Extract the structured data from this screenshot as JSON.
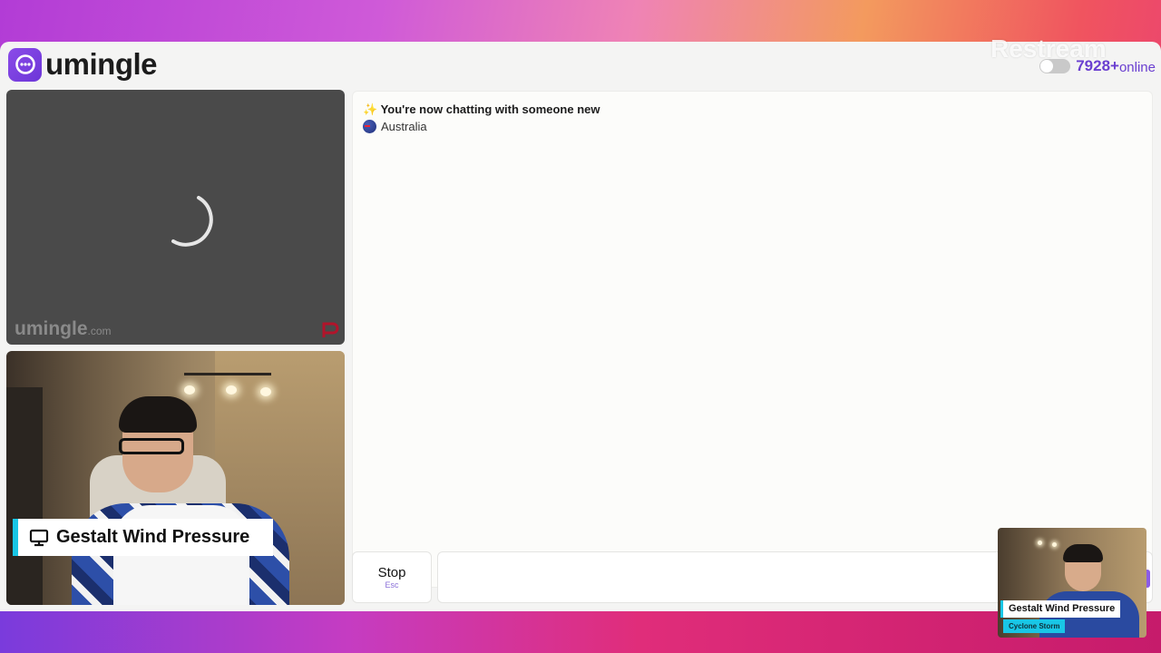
{
  "app": {
    "brand": "umingle",
    "watermark": "Restream",
    "online_count": "7928+",
    "online_label": "online"
  },
  "stranger_video": {
    "watermark_name": "umingle",
    "watermark_domain": ".com"
  },
  "self_video": {
    "name_overlay": "Gestalt Wind Pressure"
  },
  "chat": {
    "status_emoji": "✨",
    "status_text": "You're now chatting with someone new",
    "country": "Australia"
  },
  "controls": {
    "stop_label": "Stop",
    "stop_shortcut": "Esc",
    "message_value": "",
    "message_placeholder": ""
  },
  "pip": {
    "name": "Gestalt Wind Pressure",
    "subtitle": "Cyclone Storm"
  },
  "colors": {
    "accent": "#6a3fd0",
    "lower_third_bar": "#19c6e6"
  }
}
